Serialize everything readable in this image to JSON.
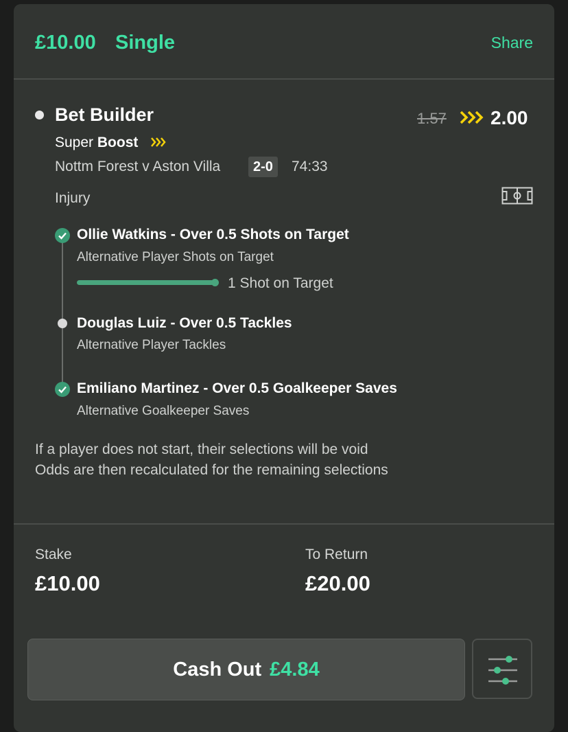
{
  "header": {
    "amount": "£10.00",
    "bet_type": "Single",
    "share_label": "Share"
  },
  "bet": {
    "title": "Bet Builder",
    "old_odds": "1.57",
    "new_odds": "2.00",
    "super_label": "Super",
    "boost_label": "Boost",
    "match": "Nottm Forest v Aston Villa",
    "score": "2-0",
    "clock": "74:33",
    "status": "Injury",
    "legs": [
      {
        "title": "Ollie Watkins - Over 0.5 Shots on Target",
        "subtitle": "Alternative Player Shots on Target",
        "state": "won",
        "progress_label": "1 Shot on Target",
        "progress": 1.0
      },
      {
        "title": "Douglas Luiz - Over 0.5 Tackles",
        "subtitle": "Alternative Player Tackles",
        "state": "pending"
      },
      {
        "title": "Emiliano Martinez - Over 0.5 Goalkeeper Saves",
        "subtitle": "Alternative Goalkeeper Saves",
        "state": "won"
      }
    ],
    "note_line1": "If a player does not start, their selections will be void",
    "note_line2": "Odds are then recalculated for the remaining selections"
  },
  "summary": {
    "stake_label": "Stake",
    "stake_value": "£10.00",
    "return_label": "To Return",
    "return_value": "£20.00"
  },
  "cashout": {
    "label": "Cash Out",
    "amount": "£4.84"
  },
  "colors": {
    "accent_green": "#3fe0a4",
    "boost_yellow": "#f5d20a",
    "check_green": "#3a9c75",
    "card_bg": "#323532"
  }
}
